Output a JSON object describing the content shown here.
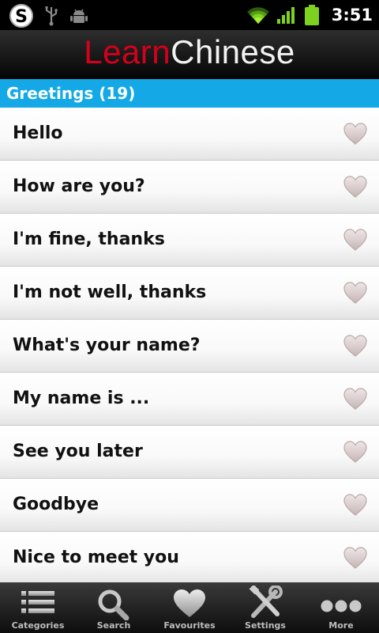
{
  "status_bar": {
    "time": "3:51",
    "left_icons": [
      "skype-icon",
      "usb-icon",
      "android-debug-icon"
    ],
    "right_icons": [
      "wifi-icon",
      "signal-icon",
      "battery-icon"
    ]
  },
  "header": {
    "logo_part1": "Learn",
    "logo_part2": "Chinese",
    "colors": {
      "learn": "#d5001c",
      "chinese": "#f2f2f2"
    }
  },
  "section": {
    "title": "Greetings (19)",
    "color": "#14a9e6"
  },
  "phrases": [
    "Hello",
    "How are you?",
    "I'm fine, thanks",
    "I'm not well, thanks",
    "What's your name?",
    "My name is ...",
    "See you later",
    "Goodbye",
    "Nice to meet you"
  ],
  "tabs": [
    {
      "label": "Categories",
      "icon": "list-icon"
    },
    {
      "label": "Search",
      "icon": "search-icon"
    },
    {
      "label": "Favourites",
      "icon": "heart-icon"
    },
    {
      "label": "Settings",
      "icon": "tools-icon"
    },
    {
      "label": "More",
      "icon": "more-icon"
    }
  ]
}
